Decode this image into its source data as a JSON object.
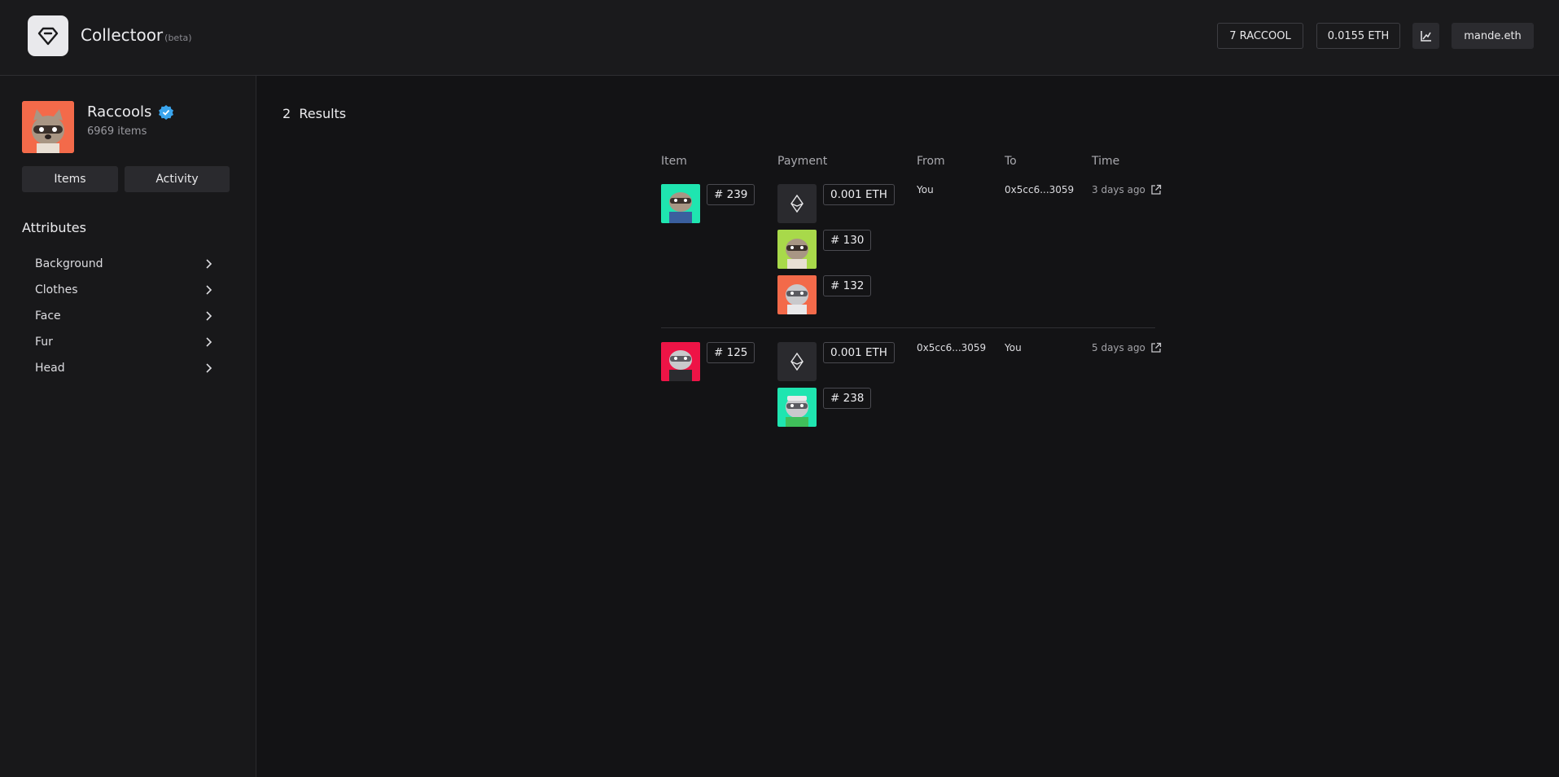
{
  "header": {
    "app_name": "Collectoor",
    "beta_label": "(beta)",
    "token_balance": "7 RACCOOL",
    "eth_balance": "0.0155 ETH",
    "chart_icon": "chart-icon",
    "account": "mande.eth"
  },
  "sidebar": {
    "collection_name": "Raccools",
    "collection_count": "6969 items",
    "verified_icon": "verified-badge-icon",
    "tabs": [
      {
        "label": "Items"
      },
      {
        "label": "Activity"
      }
    ],
    "attributes_heading": "Attributes",
    "attributes": [
      {
        "label": "Background"
      },
      {
        "label": "Clothes"
      },
      {
        "label": "Face"
      },
      {
        "label": "Fur"
      },
      {
        "label": "Head"
      }
    ]
  },
  "main": {
    "results_count": "2",
    "results_label": "Results",
    "columns": [
      "Item",
      "Payment",
      "From",
      "To",
      "Time"
    ],
    "rows": [
      {
        "item": {
          "tag": "# 239",
          "bg": "#1fe5b0"
        },
        "payment": [
          {
            "type": "eth",
            "tag": "0.001 ETH"
          },
          {
            "type": "nft",
            "tag": "# 130",
            "bg": "#a8d94a"
          },
          {
            "type": "nft",
            "tag": "# 132",
            "bg": "#f36a4a"
          }
        ],
        "from": "You",
        "to": "0x5cc6...3059",
        "time": "3 days ago"
      },
      {
        "item": {
          "tag": "# 125",
          "bg": "#ee1446"
        },
        "payment": [
          {
            "type": "eth",
            "tag": "0.001 ETH"
          },
          {
            "type": "nft",
            "tag": "# 238",
            "bg": "#1fe5b0"
          }
        ],
        "from": "0x5cc6...3059",
        "to": "You",
        "time": "5 days ago"
      }
    ]
  }
}
